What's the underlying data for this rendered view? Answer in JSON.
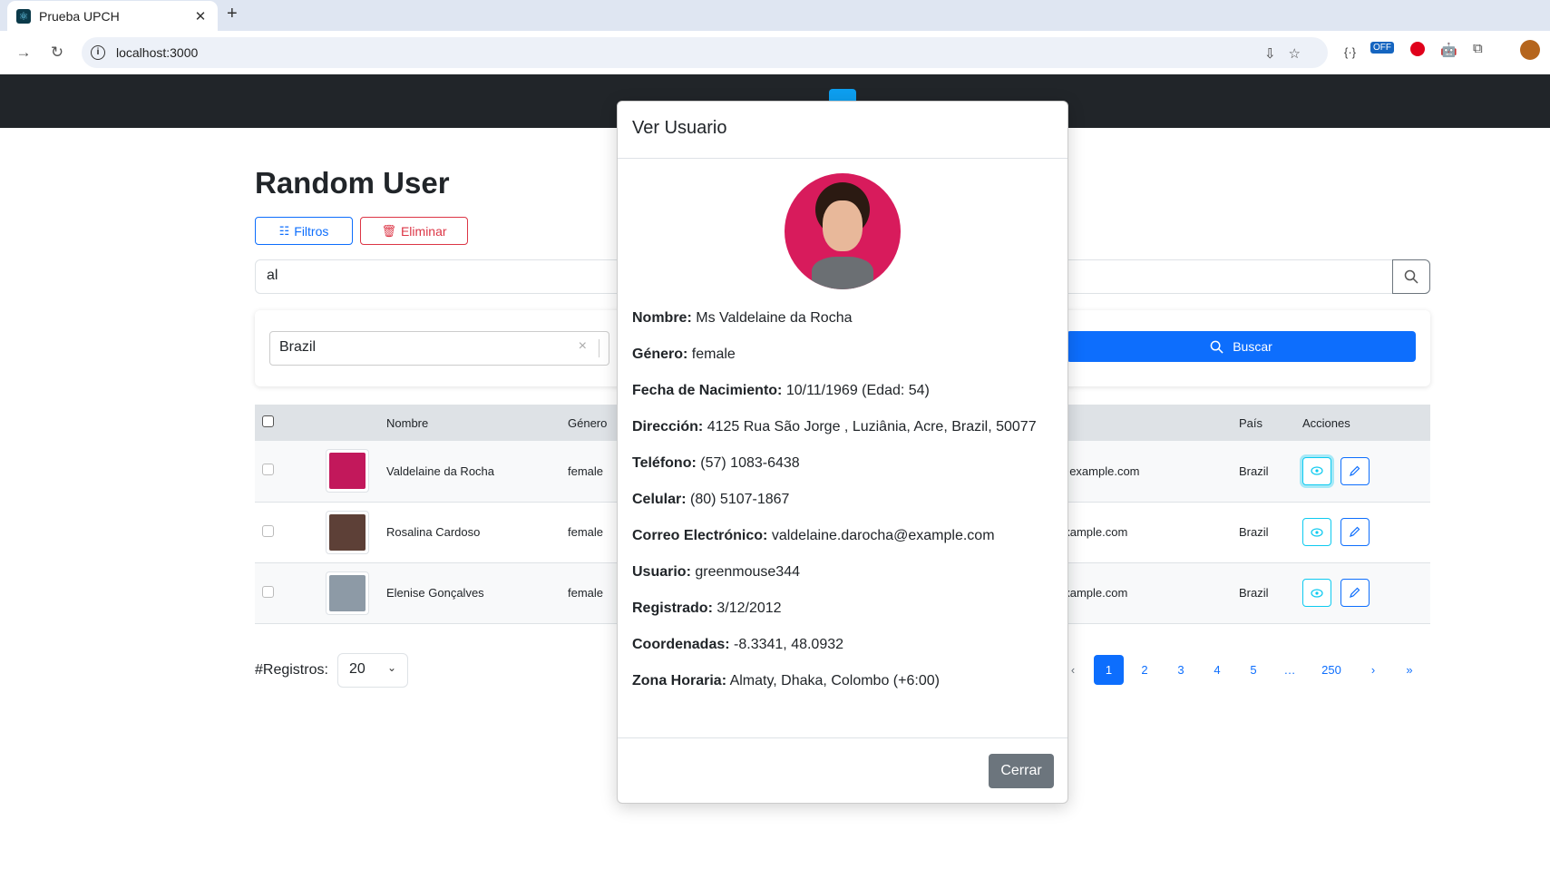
{
  "browser": {
    "tab_title": "Prueba UPCH",
    "tab_close": "✕",
    "new_tab": "+",
    "url": "localhost:3000",
    "ext_off_badge": "OFF"
  },
  "app": {
    "title": "Random User",
    "filtros_label": "Filtros",
    "eliminar_label": "Eliminar",
    "search_value": "al",
    "country_value": "Brazil",
    "buscar_label": "Buscar",
    "table_headers": {
      "nombre": "Nombre",
      "genero": "Género",
      "email_partial": "",
      "pais": "País",
      "acciones": "Acciones"
    },
    "rows": [
      {
        "name": "Valdelaine da Rocha",
        "gender": "female",
        "email_tail": "@example.com",
        "country": "Brazil",
        "photo_color": "#c2185b"
      },
      {
        "name": "Rosalina Cardoso",
        "gender": "female",
        "email_tail": "example.com",
        "country": "Brazil",
        "photo_color": "#5d4037"
      },
      {
        "name": "Elenise Gonçalves",
        "gender": "female",
        "email_tail": "example.com",
        "country": "Brazil",
        "photo_color": "#8d9aa6"
      }
    ],
    "registros_label": "#Registros:",
    "registros_value": "20",
    "pagination": {
      "prev": "‹",
      "pages": [
        "1",
        "2",
        "3",
        "4",
        "5"
      ],
      "ellipsis": "…",
      "last_page": "250",
      "next": "›",
      "last": "»",
      "active": "1"
    }
  },
  "modal": {
    "title": "Ver Usuario",
    "fields": [
      {
        "label": "Nombre:",
        "value": "Ms Valdelaine da Rocha"
      },
      {
        "label": "Género:",
        "value": "female"
      },
      {
        "label": "Fecha de Nacimiento:",
        "value": "10/11/1969 (Edad: 54)"
      },
      {
        "label": "Dirección:",
        "value": "4125 Rua São Jorge , Luziânia, Acre, Brazil, 50077"
      },
      {
        "label": "Teléfono:",
        "value": "(57) 1083-6438"
      },
      {
        "label": "Celular:",
        "value": "(80) 5107-1867"
      },
      {
        "label": "Correo Electrónico:",
        "value": "valdelaine.darocha@example.com"
      },
      {
        "label": "Usuario:",
        "value": "greenmouse344"
      },
      {
        "label": "Registrado:",
        "value": "3/12/2012"
      },
      {
        "label": "Coordenadas:",
        "value": "-8.3341, 48.0932"
      },
      {
        "label": "Zona Horaria:",
        "value": "Almaty, Dhaka, Colombo (+6:00)"
      }
    ],
    "close_label": "Cerrar"
  },
  "colors": {
    "primary": "#0d6efd",
    "danger": "#dc3545",
    "info": "#0dcaf0",
    "navbar": "#212529",
    "secondary": "#6c757d"
  }
}
